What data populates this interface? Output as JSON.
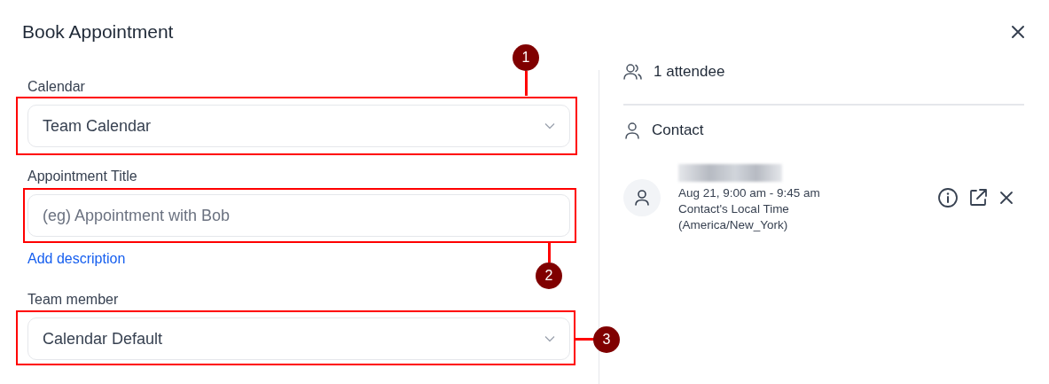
{
  "dialog": {
    "title": "Book Appointment"
  },
  "form": {
    "fields": [
      {
        "kind": "select",
        "label": "Calendar",
        "value": "Team Calendar",
        "callout": "1"
      },
      {
        "kind": "text",
        "label": "Appointment Title",
        "placeholder": "(eg) Appointment with Bob",
        "callout": "2",
        "link": "Add description"
      },
      {
        "kind": "select",
        "label": "Team member",
        "value": "Calendar Default",
        "callout": "3"
      }
    ]
  },
  "attendees": {
    "count_label": "1 attendee",
    "section_label": "Contact",
    "contact": {
      "time": "Aug 21, 9:00 am - 9:45 am",
      "timezone_label": "Contact's Local Time",
      "timezone": "(America/New_York)"
    }
  }
}
